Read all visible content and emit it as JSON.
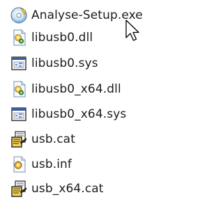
{
  "files": [
    {
      "name": "Analyse-Setup.exe",
      "icon": "setup-exe-icon"
    },
    {
      "name": "libusb0.dll",
      "icon": "dll-icon"
    },
    {
      "name": "libusb0.sys",
      "icon": "sys-icon"
    },
    {
      "name": "libusb0_x64.dll",
      "icon": "dll-icon"
    },
    {
      "name": "libusb0_x64.sys",
      "icon": "sys-icon"
    },
    {
      "name": "usb.cat",
      "icon": "security-catalog-icon"
    },
    {
      "name": "usb.inf",
      "icon": "inf-icon"
    },
    {
      "name": "usb_x64.cat",
      "icon": "security-catalog-icon"
    }
  ],
  "cursor": {
    "icon": "mouse-pointer-icon"
  }
}
